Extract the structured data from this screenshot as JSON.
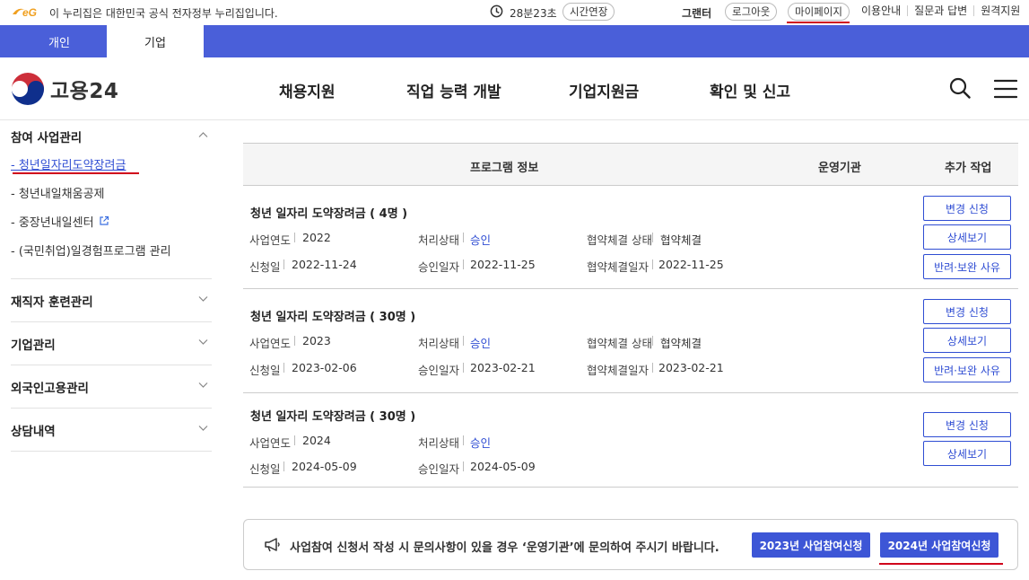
{
  "gov_bar": {
    "notice": "이 누리집은 대한민국 공식 전자정부 누리집입니다.",
    "timer": "28분23초",
    "extend": "시간연장",
    "user_name": "그랜터",
    "logout": "로그아웃",
    "mypage": "마이페이지",
    "links": [
      "이용안내",
      "질문과 답변",
      "원격지원"
    ]
  },
  "tabs": [
    "개인",
    "기업"
  ],
  "header": {
    "logo_text": "고용24",
    "nav": [
      "채용지원",
      "직업 능력 개발",
      "기업지원금",
      "확인 및 신고"
    ]
  },
  "sidebar": {
    "sections": [
      {
        "label": "참여 사업관리",
        "items": [
          "- 청년일자리도약장려금",
          "- 청년내일채움공제",
          "- 중장년내일센터",
          "- (국민취업)일경험프로그램 관리"
        ]
      },
      {
        "label": "재직자 훈련관리"
      },
      {
        "label": "기업관리"
      },
      {
        "label": "외국인고용관리"
      },
      {
        "label": "상담내역"
      }
    ]
  },
  "table": {
    "headers": [
      "프로그램 정보",
      "운영기관",
      "추가 작업"
    ],
    "field_labels": {
      "year": "사업연도",
      "status": "처리상태",
      "contract_status": "협약체결 상태",
      "apply_date": "신청일",
      "approve_date": "승인일자",
      "contract_date": "협약체결일자"
    },
    "rows": [
      {
        "title": "청년 일자리 도약장려금 ( 4명 )",
        "year": "2022",
        "status": "승인",
        "contract_status": "협약체결",
        "apply_date": "2022-11-24",
        "approve_date": "2022-11-25",
        "contract_date": "2022-11-25",
        "buttons": [
          "변경 신청",
          "상세보기",
          "반려·보완 사유"
        ]
      },
      {
        "title": "청년 일자리 도약장려금 ( 30명 )",
        "year": "2023",
        "status": "승인",
        "contract_status": "협약체결",
        "apply_date": "2023-02-06",
        "approve_date": "2023-02-21",
        "contract_date": "2023-02-21",
        "buttons": [
          "변경 신청",
          "상세보기",
          "반려·보완 사유"
        ]
      },
      {
        "title": "청년 일자리 도약장려금 ( 30명 )",
        "year": "2024",
        "status": "승인",
        "apply_date": "2024-05-09",
        "approve_date": "2024-05-09",
        "buttons": [
          "변경 신청",
          "상세보기"
        ]
      }
    ]
  },
  "notice": {
    "text": "사업참여 신청서 작성 시 문의사항이 있을 경우 ‘운영기관’에 문의하여 주시기 바랍니다.",
    "btn_2023": "2023년 사업참여신청",
    "btn_2024": "2024년 사업참여신청"
  },
  "colors": {
    "brand_blue": "#4a5fd9",
    "link_blue": "#2f4dd3",
    "highlight_red": "#d0021b"
  },
  "icons": [
    "eg-logo-icon",
    "clock-icon",
    "goyong-logo-icon",
    "search-icon",
    "menu-icon",
    "chevron-down-icon",
    "external-link-icon",
    "megaphone-icon"
  ]
}
